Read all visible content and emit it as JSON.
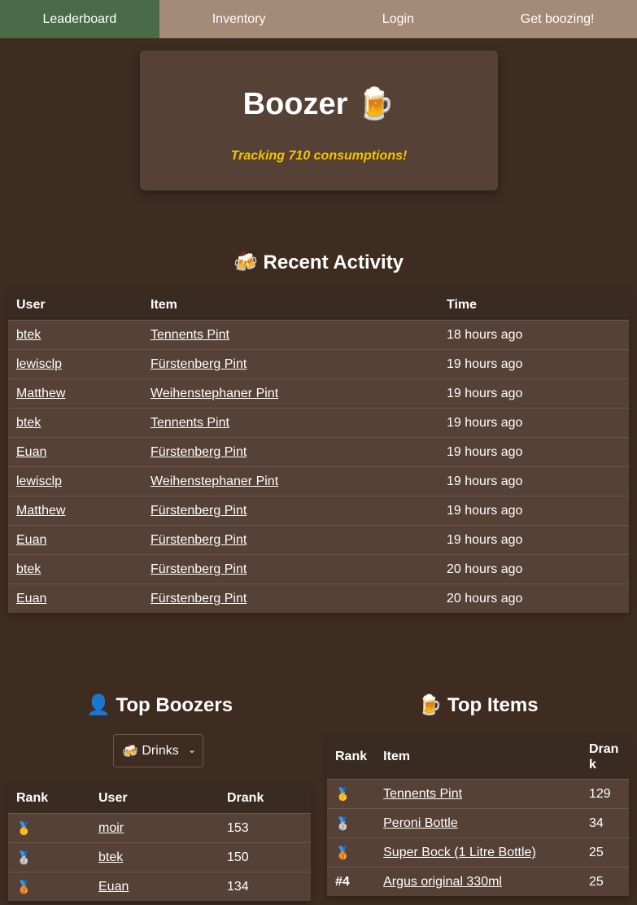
{
  "nav": {
    "items": [
      {
        "label": "Leaderboard",
        "active": true
      },
      {
        "label": "Inventory"
      },
      {
        "label": "Login"
      },
      {
        "label": "Get boozing!"
      }
    ]
  },
  "hero": {
    "title": "Boozer",
    "title_icon": "🍺",
    "tagline": "Tracking 710 consumptions!"
  },
  "recent": {
    "title": "Recent Activity",
    "title_icon": "🍻",
    "headers": {
      "user": "User",
      "item": "Item",
      "time": "Time"
    },
    "rows": [
      {
        "user": "btek",
        "item": "Tennents Pint",
        "time": "18 hours ago"
      },
      {
        "user": "lewisclp",
        "item": "Fürstenberg Pint",
        "time": "19 hours ago"
      },
      {
        "user": "Matthew",
        "item": "Weihenstephaner Pint",
        "time": "19 hours ago"
      },
      {
        "user": "btek",
        "item": "Tennents Pint",
        "time": "19 hours ago"
      },
      {
        "user": "Euan",
        "item": "Fürstenberg Pint",
        "time": "19 hours ago"
      },
      {
        "user": "lewisclp",
        "item": "Weihenstephaner Pint",
        "time": "19 hours ago"
      },
      {
        "user": "Matthew",
        "item": "Fürstenberg Pint",
        "time": "19 hours ago"
      },
      {
        "user": "Euan",
        "item": "Fürstenberg Pint",
        "time": "19 hours ago"
      },
      {
        "user": "btek",
        "item": "Fürstenberg Pint",
        "time": "20 hours ago"
      },
      {
        "user": "Euan",
        "item": "Fürstenberg Pint",
        "time": "20 hours ago"
      }
    ]
  },
  "top_boozers": {
    "title": "Top Boozers",
    "title_icon": "👤",
    "filter": {
      "icon": "🍻",
      "selected": "Drinks"
    },
    "headers": {
      "rank": "Rank",
      "user": "User",
      "drank": "Drank"
    },
    "rows": [
      {
        "rank": "🥇",
        "user": "moir",
        "drank": "153"
      },
      {
        "rank": "🥈",
        "user": "btek",
        "drank": "150"
      },
      {
        "rank": "🥉",
        "user": "Euan",
        "drank": "134"
      }
    ]
  },
  "top_items": {
    "title": "Top Items",
    "title_icon": "🍺",
    "headers": {
      "rank": "Rank",
      "item": "Item",
      "drank": "Drank"
    },
    "rows": [
      {
        "rank": "🥇",
        "item": "Tennents Pint",
        "drank": "129"
      },
      {
        "rank": "🥈",
        "item": "Peroni Bottle",
        "drank": "34"
      },
      {
        "rank": "🥉",
        "item": "Super Bock (1 Litre Bottle)",
        "drank": "25"
      },
      {
        "rank": "#4",
        "item": "Argus original 330ml",
        "drank": "25"
      }
    ]
  }
}
